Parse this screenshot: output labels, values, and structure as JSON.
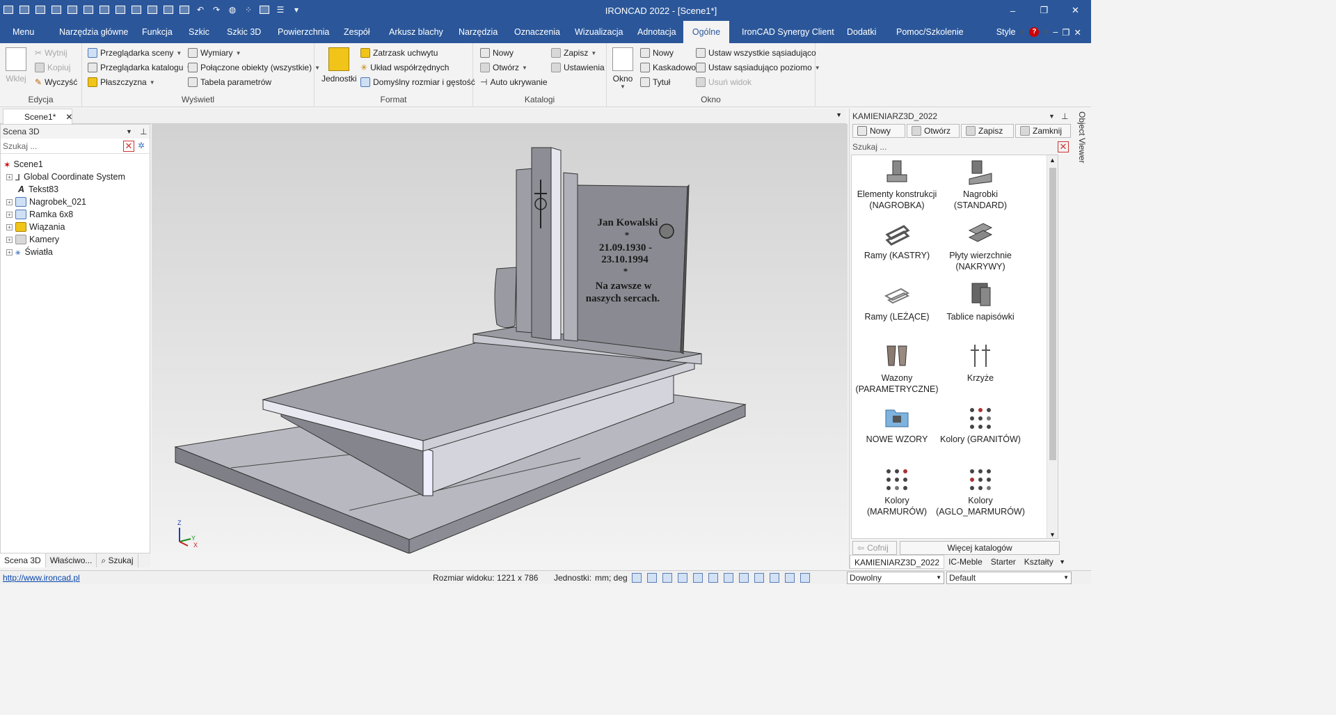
{
  "app": {
    "title": "IRONCAD 2022 - [Scene1*]",
    "window_controls": [
      "–",
      "❐",
      "✕"
    ]
  },
  "ribbon_tabs": [
    "Menu",
    "Narzędzia główne",
    "Funkcja",
    "Szkic",
    "Szkic 3D",
    "Powierzchnia",
    "Zespół",
    "Arkusz blachy",
    "Narzędzia",
    "Oznaczenia",
    "Wizualizacja",
    "Adnotacja",
    "Ogólne",
    "IronCAD Synergy Client",
    "Dodatki",
    "Pomoc/Szkolenie"
  ],
  "active_tab": "Ogólne",
  "style_label": "Style",
  "ribbon": {
    "edycja": {
      "label": "Edycja",
      "wklej": "Wklej",
      "wytnij": "Wytnij",
      "kopiuj": "Kopiuj",
      "wyczysc": "Wyczyść"
    },
    "wyswietl": {
      "label": "Wyświetl",
      "przegladarka_sceny": "Przeglądarka sceny",
      "przegladarka_katalogu": "Przeglądarka katalogu",
      "plaszczyzna": "Płaszczyzna",
      "wymiary": "Wymiary",
      "polaczone": "Połączone obiekty (wszystkie)",
      "tabela": "Tabela parametrów"
    },
    "format": {
      "label": "Format",
      "jednostki": "Jednostki",
      "zatrzask": "Zatrzask uchwytu",
      "uklad": "Układ współrzędnych",
      "domyslny": "Domyślny rozmiar i gęstość"
    },
    "katalogi": {
      "label": "Katalogi",
      "nowy": "Nowy",
      "otworz": "Otwórz",
      "auto": "Auto ukrywanie",
      "zapisz": "Zapisz",
      "ustawienia": "Ustawienia"
    },
    "okno": {
      "label": "Okno",
      "okno": "Okno",
      "nowy": "Nowy",
      "kaskadowo": "Kaskadowo",
      "tytul": "Tytuł",
      "ustaw_wszystkie": "Ustaw wszystkie sąsiadująco",
      "ustaw_poziomo": "Ustaw sąsiadująco poziomo",
      "usun": "Usuń widok"
    }
  },
  "document_tab": "Scene1*",
  "scene_panel": {
    "title": "Scena 3D",
    "search_placeholder": "Szukaj ...",
    "tree": [
      {
        "label": "Scene1",
        "expandable": false,
        "icon": "scene-icon"
      },
      {
        "label": "Global Coordinate System",
        "expandable": true,
        "icon": "axes-icon"
      },
      {
        "label": "Tekst83",
        "expandable": false,
        "icon": "text-icon"
      },
      {
        "label": "Nagrobek_021",
        "expandable": true,
        "icon": "part-icon"
      },
      {
        "label": "Ramka 6x8",
        "expandable": true,
        "icon": "part-icon"
      },
      {
        "label": "Wiązania",
        "expandable": true,
        "icon": "constraint-icon"
      },
      {
        "label": "Kamery",
        "expandable": true,
        "icon": "camera-icon"
      },
      {
        "label": "Światła",
        "expandable": true,
        "icon": "light-icon"
      }
    ],
    "bottom_tabs": [
      "Scena 3D",
      "Właściwo...",
      "Szukaj"
    ]
  },
  "headstone": {
    "line1": "Jan Kowalski",
    "line2": "*",
    "line3": "21.09.1930 -",
    "line4": "23.10.1994",
    "line5": "*",
    "line6": "Na zawsze w",
    "line7": "naszych sercach."
  },
  "axis_labels": {
    "z": "Z",
    "y": "Y",
    "x": "X"
  },
  "catalog_panel": {
    "title": "KAMIENIARZ3D_2022",
    "toolbar": [
      "Nowy",
      "Otwórz",
      "Zapisz",
      "Zamknij"
    ],
    "search_placeholder": "Szukaj ...",
    "items": [
      {
        "l1": "Elementy konstrukcji",
        "l2": "(NAGROBKA)"
      },
      {
        "l1": "Nagrobki",
        "l2": "(STANDARD)"
      },
      {
        "l1": "Ramy (KASTRY)",
        "l2": ""
      },
      {
        "l1": "Płyty wierzchnie",
        "l2": "(NAKRYWY)"
      },
      {
        "l1": "Ramy (LEŻĄCE)",
        "l2": ""
      },
      {
        "l1": "Tablice napisówki",
        "l2": ""
      },
      {
        "l1": "Wazony",
        "l2": "(PARAMETRYCZNE)"
      },
      {
        "l1": "Krzyże",
        "l2": ""
      },
      {
        "l1": "NOWE WZORY",
        "l2": ""
      },
      {
        "l1": "Kolory (GRANITÓW)",
        "l2": ""
      },
      {
        "l1": "Kolory",
        "l2": "(MARMURÓW)"
      },
      {
        "l1": "Kolory",
        "l2": "(AGLO_MARMURÓW)"
      }
    ],
    "back_label": "Cofnij",
    "more_label": "Więcej katalogów",
    "tabs": [
      "KAMIENIARZ3D_2022",
      "IC-Meble",
      "Starter",
      "Kształty"
    ]
  },
  "object_viewer": "Object Viewer",
  "status": {
    "link": "http://www.ironcad.pl",
    "view_size": "Rozmiar widoku: 1221 x  786",
    "units_label": "Jednostki:",
    "units_value": "mm; deg",
    "combo1": "Dowolny",
    "combo2": "Default"
  }
}
